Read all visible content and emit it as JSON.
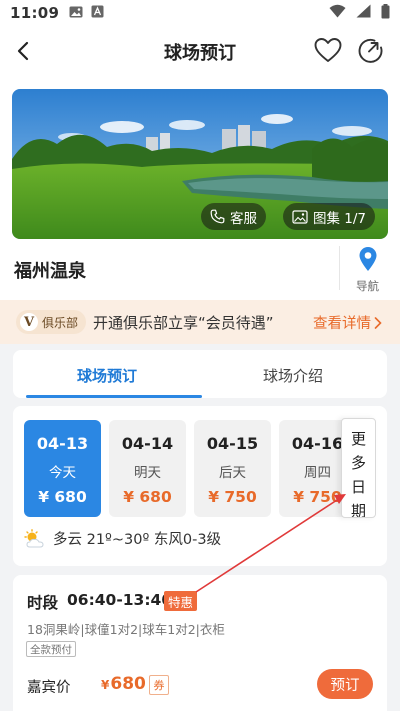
{
  "status_bar": {
    "time": "11:09"
  },
  "header": {
    "title": "球场预订"
  },
  "gallery": {
    "service_label": "客服",
    "gallery_label": "图集 1/7"
  },
  "course": {
    "name": "福州温泉",
    "nav_label": "导航"
  },
  "club_banner": {
    "badge": "俱乐部",
    "promo_text": "开通俱乐部立享“会员待遇”",
    "details_label": "查看详情"
  },
  "tabs": [
    {
      "label": "球场预订",
      "active": true
    },
    {
      "label": "球场介绍",
      "active": false
    }
  ],
  "dates": [
    {
      "date": "04-13",
      "day": "今天",
      "price": "¥ 680",
      "selected": true
    },
    {
      "date": "04-14",
      "day": "明天",
      "price": "¥ 680",
      "selected": false
    },
    {
      "date": "04-15",
      "day": "后天",
      "price": "¥ 750",
      "selected": false
    },
    {
      "date": "04-16",
      "day": "周四",
      "price": "¥ 750",
      "selected": false
    }
  ],
  "more_dates": {
    "c1": "更",
    "c2": "多",
    "c3": "日",
    "c4": "期"
  },
  "weather": {
    "text": "多云  21º~30º 东风0-3级"
  },
  "slot": {
    "label": "时段",
    "time": "06:40-13:40",
    "tag": "特惠",
    "description": "18洞果岭|球僮1对2|球车1对2|衣柜",
    "payment": "全款预付",
    "guest_label": "嘉宾价",
    "currency": "¥",
    "price": "680",
    "coupon": "券",
    "book_label": "预订"
  },
  "colors": {
    "accent_blue": "#2b87e3",
    "accent_orange": "#ef6b3b",
    "annotation_red": "#e03a3a"
  }
}
